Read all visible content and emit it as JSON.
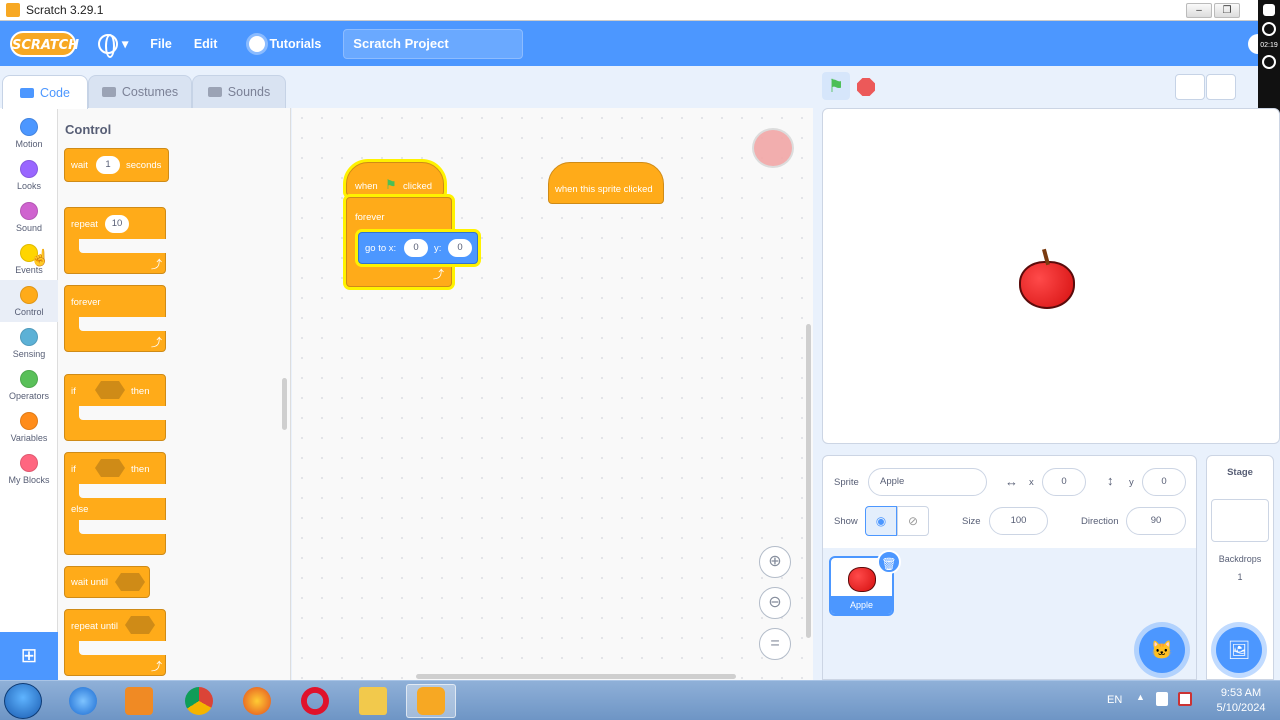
{
  "window": {
    "title": "Scratch 3.29.1"
  },
  "menu": {
    "logo": "SCRATCH",
    "file": "File",
    "edit": "Edit",
    "tutorials": "Tutorials",
    "project_title": "Scratch Project"
  },
  "recorder": {
    "timer": "02:19"
  },
  "tabs": [
    {
      "label": "Code"
    },
    {
      "label": "Costumes"
    },
    {
      "label": "Sounds"
    }
  ],
  "categories": [
    {
      "label": "Motion",
      "color": "#4c97ff"
    },
    {
      "label": "Looks",
      "color": "#9966ff"
    },
    {
      "label": "Sound",
      "color": "#cf63cf"
    },
    {
      "label": "Events",
      "color": "#ffd500"
    },
    {
      "label": "Control",
      "color": "#ffab19"
    },
    {
      "label": "Sensing",
      "color": "#5cb1d6"
    },
    {
      "label": "Operators",
      "color": "#59c059"
    },
    {
      "label": "Variables",
      "color": "#ff8c1a"
    },
    {
      "label": "My Blocks",
      "color": "#ff6680"
    }
  ],
  "palette": {
    "title": "Control",
    "wait": {
      "label": "wait",
      "value": "1",
      "suffix": "seconds"
    },
    "repeat": {
      "label": "repeat",
      "value": "10"
    },
    "forever": "forever",
    "if_then": {
      "if": "if",
      "then": "then"
    },
    "if_else": {
      "if": "if",
      "then": "then",
      "else": "else"
    },
    "wait_until": "wait until",
    "repeat_until": "repeat until"
  },
  "script": {
    "hat": {
      "when": "when",
      "clicked": "clicked"
    },
    "forever": "forever",
    "goto": {
      "label": "go to x:",
      "x": "0",
      "y_label": "y:",
      "y": "0"
    },
    "sprite_hat": "when this sprite clicked"
  },
  "sprite_info": {
    "sprite_label": "Sprite",
    "sprite_name": "Apple",
    "x_label": "x",
    "x": "0",
    "y_label": "y",
    "y": "0",
    "show_label": "Show",
    "size_label": "Size",
    "size": "100",
    "direction_label": "Direction",
    "direction": "90"
  },
  "sprite_list": [
    {
      "name": "Apple"
    }
  ],
  "stage_pane": {
    "title": "Stage",
    "backdrops_label": "Backdrops",
    "backdrops_count": "1"
  },
  "taskbar": {
    "lang": "EN",
    "time": "9:53 AM",
    "date": "5/10/2024"
  },
  "colors": {
    "accent": "#4c97ff",
    "control": "#ffab19",
    "motion": "#4c97ff"
  }
}
